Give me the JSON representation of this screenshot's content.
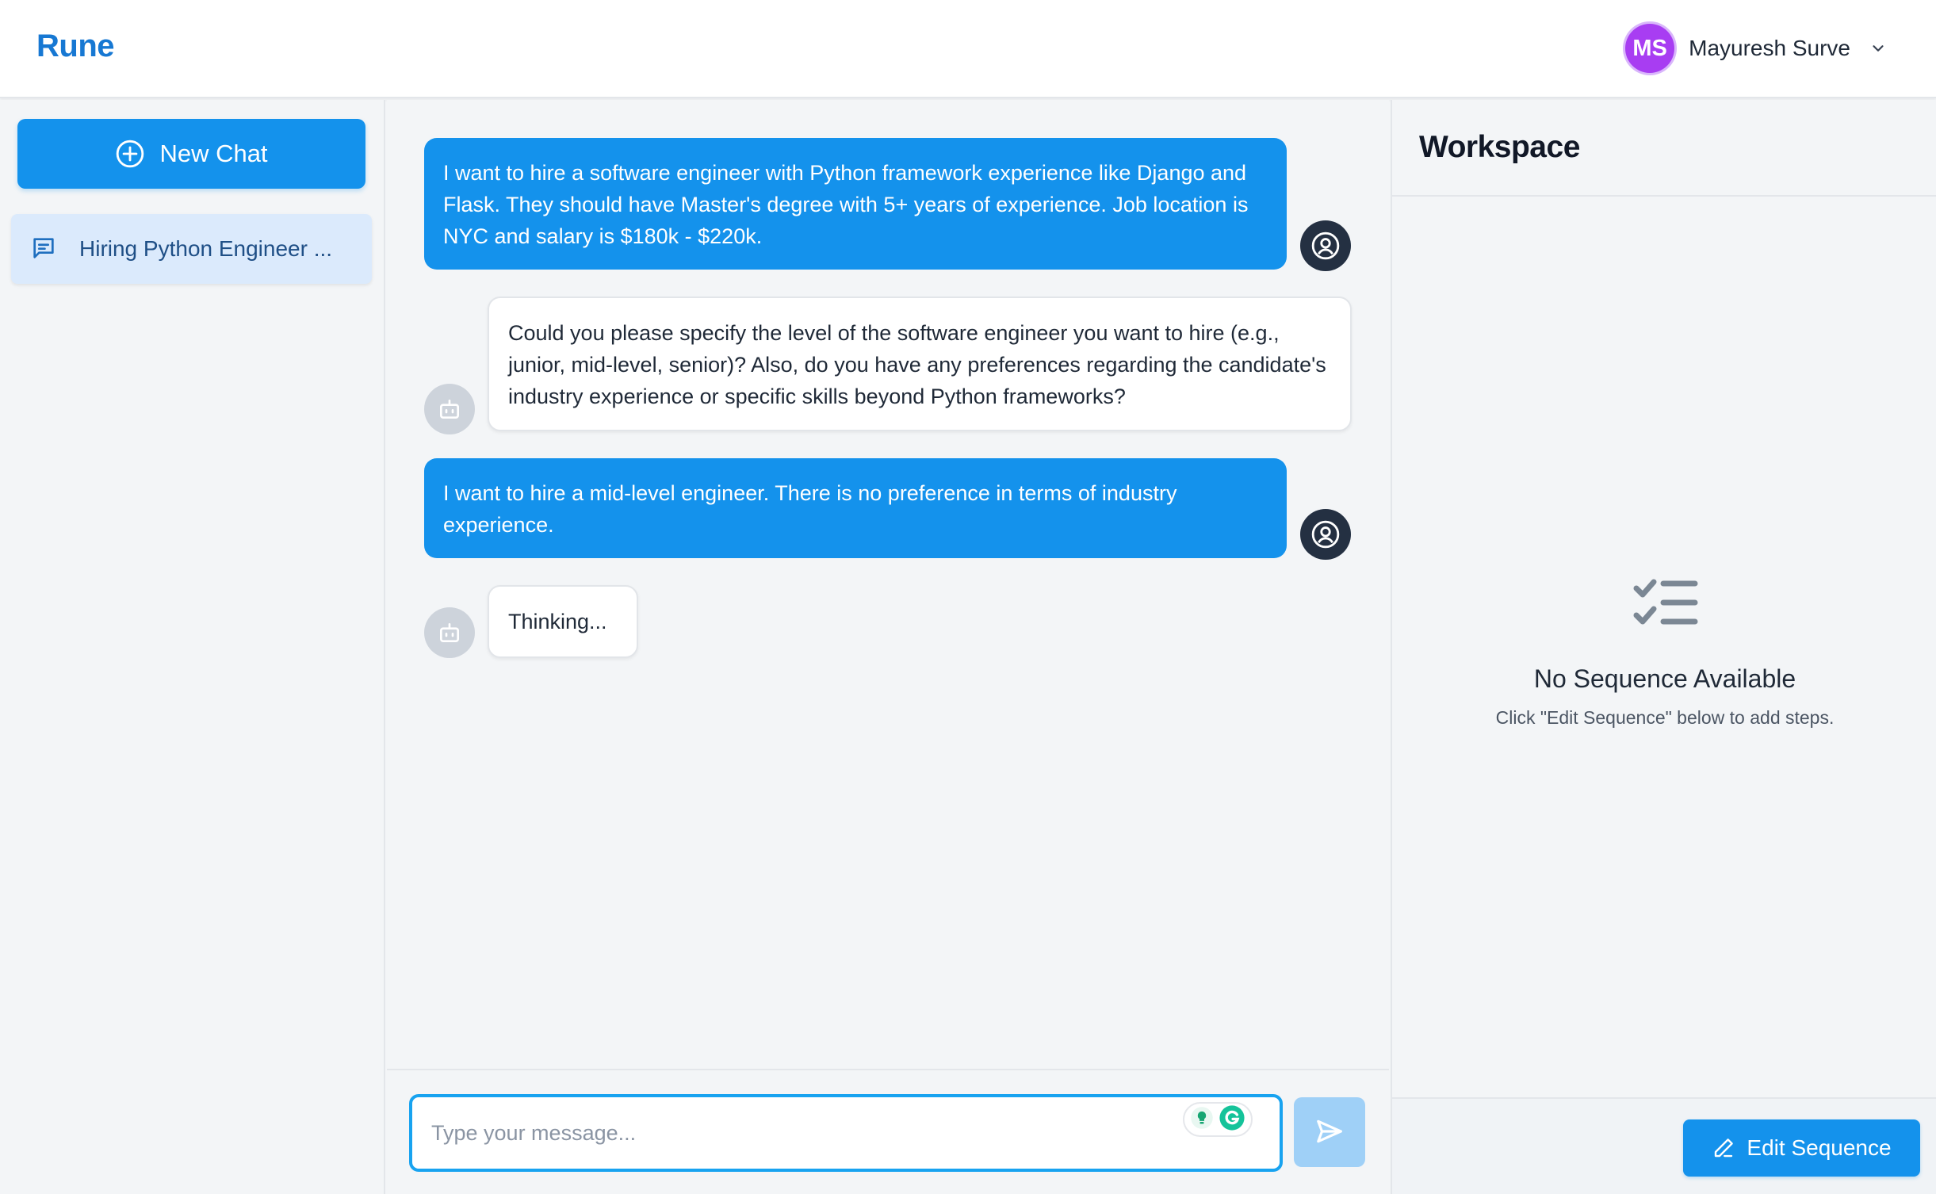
{
  "app": {
    "brand": "Rune"
  },
  "user": {
    "initials": "MS",
    "name": "Mayuresh Surve",
    "avatar_color": "#a83df2"
  },
  "sidebar": {
    "new_chat_label": "New Chat",
    "chats": [
      {
        "label": "Hiring Python Engineer ..."
      }
    ]
  },
  "chat": {
    "messages": [
      {
        "role": "user",
        "text": "I want to hire a software engineer with Python framework experience like Django and Flask. They should have Master's degree with 5+ years of experience. Job location is NYC and salary is $180k - $220k."
      },
      {
        "role": "assistant",
        "text": "Could you please specify the level of the software engineer you want to hire (e.g., junior, mid-level, senior)? Also, do you have any preferences regarding the candidate's industry experience or specific skills beyond Python frameworks?"
      },
      {
        "role": "user",
        "text": "I want to hire a mid-level engineer. There is no preference in terms of industry experience."
      },
      {
        "role": "assistant",
        "text": "Thinking..."
      }
    ],
    "input": {
      "placeholder": "Type your message...",
      "value": ""
    }
  },
  "workspace": {
    "title": "Workspace",
    "empty_title": "No Sequence Available",
    "empty_subtitle": "Click \"Edit Sequence\" below to add steps.",
    "edit_button_label": "Edit Sequence"
  },
  "colors": {
    "accent": "#1492ec",
    "brand": "#1778d3",
    "user_avatar": "#243042",
    "bot_avatar": "#cdd3db"
  },
  "icons": {
    "new_chat": "plus-circle-icon",
    "chat_item": "message-square-icon",
    "user_avatar": "user-circle-icon",
    "bot_avatar": "robot-icon",
    "send": "send-icon",
    "empty_state": "checklist-icon",
    "edit": "pencil-icon",
    "dropdown": "chevron-down-icon"
  }
}
